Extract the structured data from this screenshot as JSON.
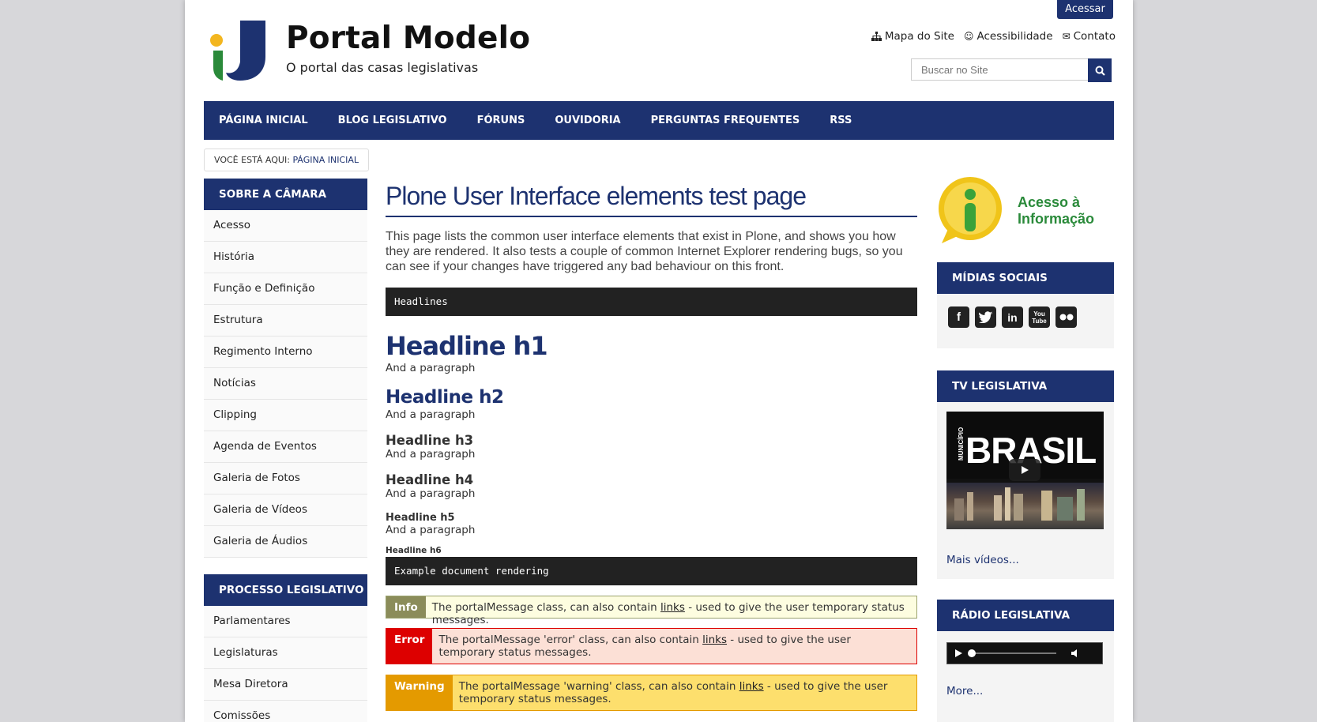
{
  "header": {
    "login_label": "Acessar",
    "site_title": "Portal Modelo",
    "site_description": "O portal das casas legislativas",
    "actions": [
      {
        "label": "Mapa do Site",
        "icon": "sitemap-icon"
      },
      {
        "label": "Acessibilidade",
        "icon": "smile-icon"
      },
      {
        "label": "Contato",
        "icon": "envelope-icon"
      }
    ],
    "search_placeholder": "Buscar no Site"
  },
  "nav": {
    "items": [
      "PÁGINA INICIAL",
      "BLOG LEGISLATIVO",
      "FÓRUNS",
      "OUVIDORIA",
      "PERGUNTAS FREQUENTES",
      "RSS"
    ]
  },
  "breadcrumb": {
    "prefix": "VOCÊ ESTÁ AQUI:",
    "current": "PÁGINA INICIAL"
  },
  "left": {
    "sobre": {
      "title": "SOBRE A CÂMARA",
      "items": [
        "Acesso",
        "História",
        "Função e Definição",
        "Estrutura",
        "Regimento Interno",
        "Notícias",
        "Clipping",
        "Agenda de Eventos",
        "Galeria de Fotos",
        "Galeria de Vídeos",
        "Galeria de Áudios"
      ]
    },
    "processo": {
      "title": "PROCESSO LEGISLATIVO",
      "items": [
        "Parlamentares",
        "Legislaturas",
        "Mesa Diretora",
        "Comissões"
      ]
    }
  },
  "content": {
    "title": "Plone User Interface elements test page",
    "description": "This page lists the common user interface elements that exist in Plone, and shows you how they are rendered. It also tests a couple of common Internet Explorer rendering bugs, so you can see if your changes have triggered any bad behaviour on this front.",
    "code1": "Headlines",
    "h1": "Headline h1",
    "h2": "Headline h2",
    "h3": "Headline h3",
    "h4": "Headline h4",
    "h5": "Headline h5",
    "h6": "Headline h6",
    "paragraph": "And a paragraph",
    "code2": "Example document rendering",
    "info": {
      "label": "Info",
      "before": "The portalMessage class, can also contain ",
      "link": "links",
      "after": " - used to give the user temporary status messages."
    },
    "error": {
      "label": "Error",
      "before": "The portalMessage 'error' class, can also contain ",
      "link": "links",
      "after": " - used to give the user temporary status messages."
    },
    "warning": {
      "label": "Warning",
      "before": "The portalMessage 'warning' class, can also contain ",
      "link": "links",
      "after": " - used to give the user temporary status messages."
    }
  },
  "right": {
    "acesso_info": {
      "line1": "Acesso à",
      "line2": "Informação"
    },
    "midias": {
      "title": "MÍDIAS SOCIAIS",
      "icons": [
        "facebook-icon",
        "twitter-icon",
        "linkedin-icon",
        "youtube-icon",
        "flickr-icon"
      ]
    },
    "tv": {
      "title": "TV LEGISLATIVA",
      "video_small_text": "MUNICÍPIO",
      "video_big_text": "BRASIL",
      "more": "Mais vídeos..."
    },
    "radio": {
      "title": "RÁDIO LEGISLATIVA",
      "more": "More..."
    }
  },
  "colors": {
    "brand": "#1d3270",
    "info": "#8b8c5a",
    "error": "#dd0000",
    "warning": "#e49a00"
  }
}
